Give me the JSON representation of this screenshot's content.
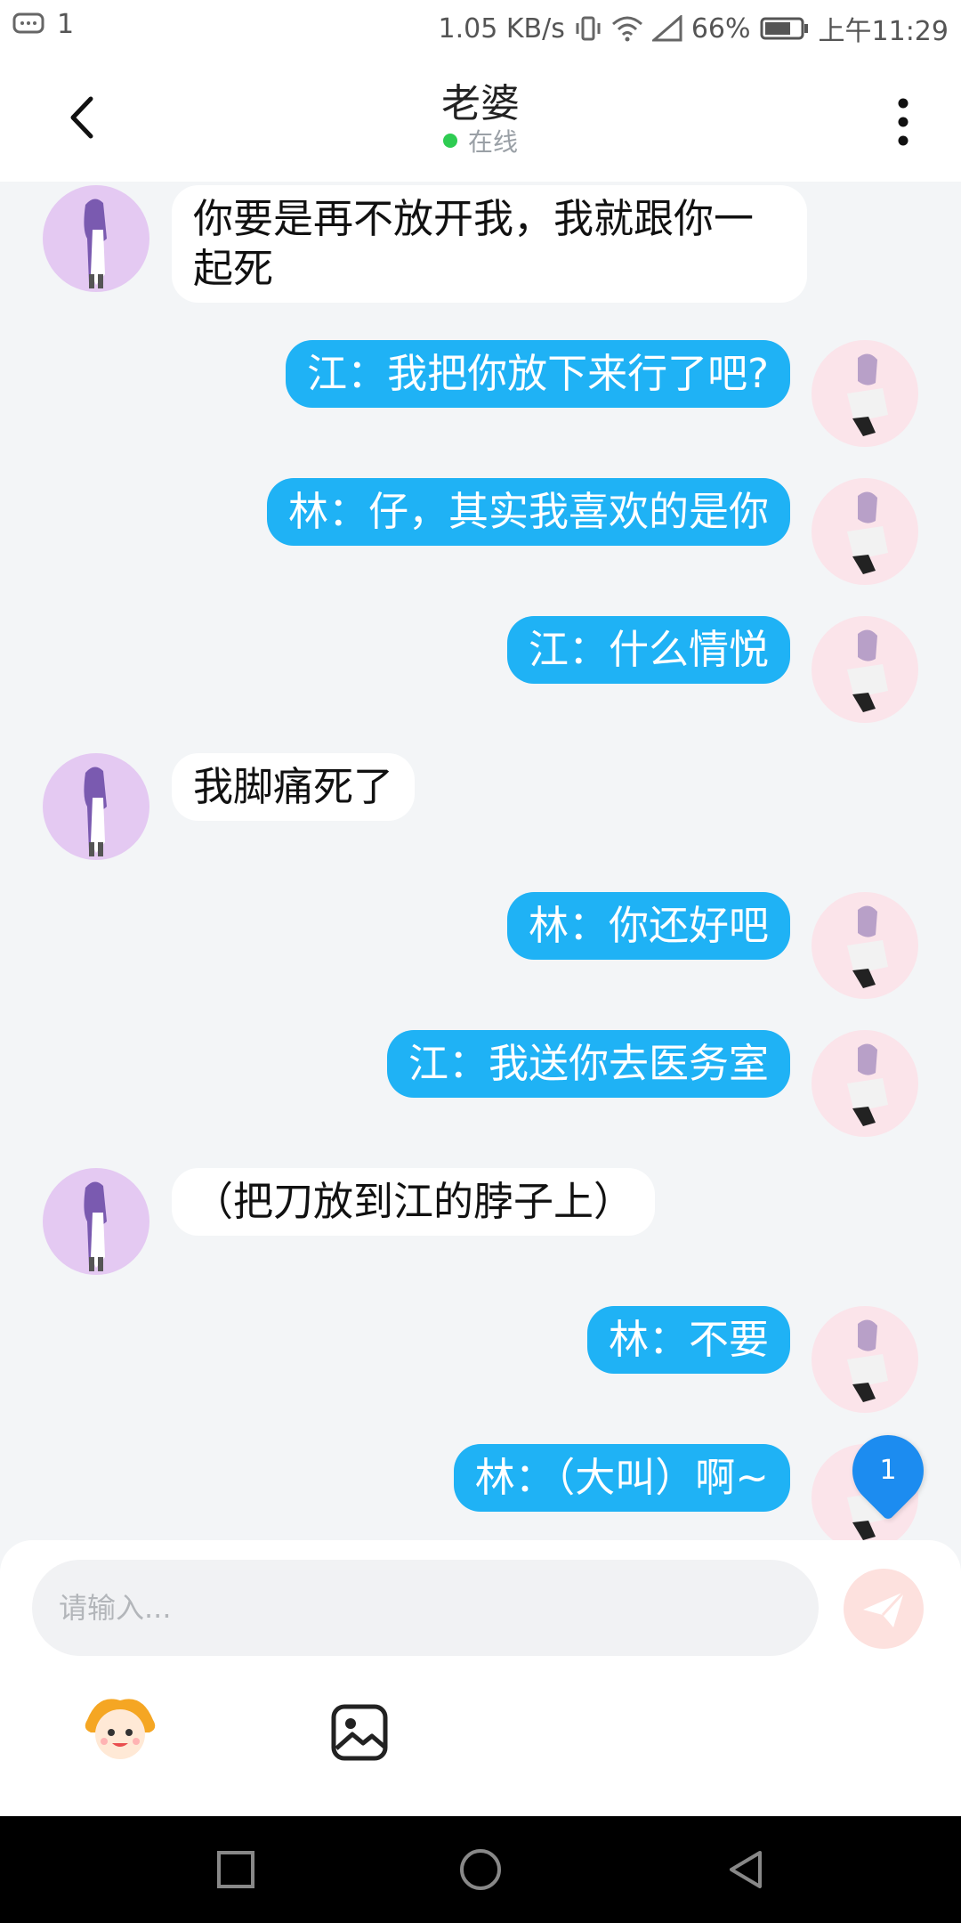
{
  "status_bar": {
    "notification_count": "1",
    "network_speed": "1.05 KB/s",
    "battery": "66%",
    "time": "上午11:29"
  },
  "header": {
    "title": "老婆",
    "status": "在线"
  },
  "messages": [
    {
      "side": "left",
      "text": "你要是再不放开我，我就跟你一起死"
    },
    {
      "side": "right",
      "text": "江：我把你放下来行了吧?"
    },
    {
      "side": "right",
      "text": "林：仔，其实我喜欢的是你"
    },
    {
      "side": "right",
      "text": "江：什么情悦"
    },
    {
      "side": "left",
      "text": "我脚痛死了"
    },
    {
      "side": "right",
      "text": "林：你还好吧"
    },
    {
      "side": "right",
      "text": "江：我送你去医务室"
    },
    {
      "side": "left",
      "text": "（把刀放到江的脖子上）"
    },
    {
      "side": "right",
      "text": "林：不要"
    },
    {
      "side": "right",
      "text": "林：（大叫）啊~"
    }
  ],
  "unread_badge": "1",
  "input": {
    "placeholder": "请输入..."
  },
  "icons": {
    "back": "back-arrow-icon",
    "more": "more-vertical-icon",
    "send": "send-icon",
    "emoji": "emoji-face-icon",
    "image": "image-icon"
  },
  "colors": {
    "bubble_right": "#1fb2f5",
    "bubble_left": "#ffffff",
    "background": "#f3f5f7",
    "online": "#2ecc52",
    "badge": "#1c8cf0"
  }
}
